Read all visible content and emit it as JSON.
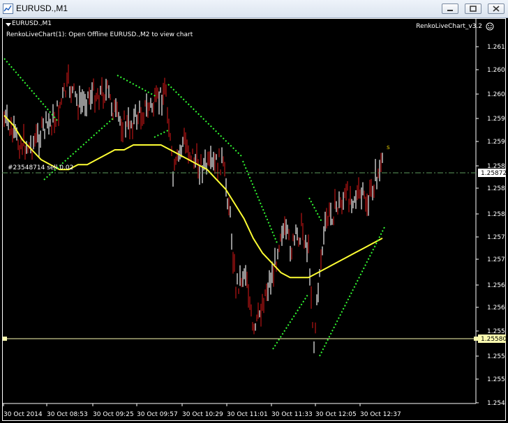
{
  "window": {
    "title": "EURUSD.,M1",
    "buttons": [
      "minimize",
      "restore",
      "close"
    ]
  },
  "chart": {
    "symbol_label": "EURUSD.,M1",
    "indicator_text": "RenkoLiveChart(1): Open Offline EURUSD.,M2 to view chart",
    "expert_name": "RenkoLiveChart_v3.2",
    "expert_icon": "smiley-icon",
    "order_label": "#23548714 sell 0.02",
    "signal_marker": "s",
    "price_axis": {
      "ticks": [
        "1.26190",
        "1.26055",
        "1.26010",
        "1.25970",
        "1.25930",
        "1.25885",
        "1.25845",
        "1.25800",
        "1.25760",
        "1.25720",
        "1.25675",
        "1.25635",
        "1.25595",
        "1.25550",
        "1.25510",
        "1.25465"
      ],
      "current_price": "1.25872",
      "order_price": "1.25580"
    },
    "time_axis": [
      "30 Oct 2014",
      "30 Oct 08:53",
      "30 Oct 09:25",
      "30 Oct 09:57",
      "30 Oct 10:29",
      "30 Oct 11:01",
      "30 Oct 11:33",
      "30 Oct 12:05",
      "30 Oct 12:37"
    ],
    "colors": {
      "background": "#000000",
      "bear_bar": "#b81414",
      "bull_bar": "#f2f2f2",
      "moving_average": "#ffff33",
      "trailing_dots": "#33ff33",
      "current_price_line": "#5e9a5e",
      "order_line": "#fbfbb0",
      "signal": "#d8c000"
    }
  },
  "chart_data": {
    "type": "candlestick",
    "y_range": [
      1.2545,
      1.2621
    ],
    "ma_series": [
      1.2605,
      1.2603,
      1.26,
      1.2598,
      1.2596,
      1.2595,
      1.2594,
      1.2594,
      1.2595,
      1.2595,
      1.2596,
      1.2597,
      1.2598,
      1.2598,
      1.2599,
      1.2599,
      1.2599,
      1.2599,
      1.2598,
      1.2597,
      1.2596,
      1.2595,
      1.2594,
      1.2592,
      1.259,
      1.2587,
      1.2584,
      1.258,
      1.2577,
      1.2575,
      1.2573,
      1.2572,
      1.2572,
      1.2572,
      1.2573,
      1.2574,
      1.2575,
      1.2576,
      1.2577,
      1.2578,
      1.2579,
      1.258
    ]
  }
}
